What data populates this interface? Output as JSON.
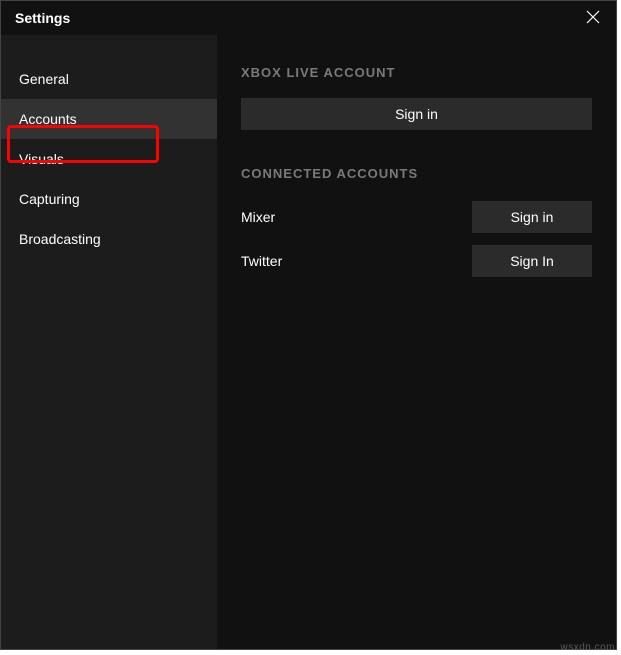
{
  "titlebar": {
    "title": "Settings"
  },
  "sidebar": {
    "items": [
      {
        "label": "General"
      },
      {
        "label": "Accounts"
      },
      {
        "label": "Visuals"
      },
      {
        "label": "Capturing"
      },
      {
        "label": "Broadcasting"
      }
    ],
    "selected_index": 1
  },
  "content": {
    "xbox_heading": "XBOX LIVE ACCOUNT",
    "xbox_signin_label": "Sign in",
    "connected_heading": "CONNECTED ACCOUNTS",
    "connected": [
      {
        "name": "Mixer",
        "button": "Sign in"
      },
      {
        "name": "Twitter",
        "button": "Sign In"
      }
    ]
  },
  "annotations": {
    "highlight_color": "#ff0000",
    "arrow_color": "#ff0000"
  },
  "watermark": "wsxdn.com"
}
